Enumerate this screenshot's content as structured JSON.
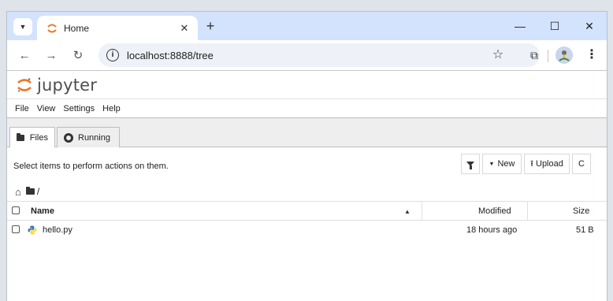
{
  "browser": {
    "tab_title": "Home",
    "tab_close": "✕",
    "new_tab": "+",
    "url": "localhost:8888/tree",
    "window_controls": {
      "minimize": "—",
      "maximize": "☐",
      "close": "✕"
    }
  },
  "jupyter": {
    "logo_text": "jupyter",
    "menu": [
      "File",
      "View",
      "Settings",
      "Help"
    ],
    "tabs": {
      "files": "Files",
      "running": "Running"
    },
    "select_hint": "Select items to perform actions on them.",
    "buttons": {
      "new": "New",
      "upload": "Upload",
      "refresh": "C"
    },
    "breadcrumb_path": "/",
    "columns": {
      "name": "Name",
      "modified": "Modified",
      "size": "Size"
    },
    "files": [
      {
        "name": "hello.py",
        "modified": "18 hours ago",
        "size": "51 B"
      }
    ]
  },
  "colors": {
    "tab_strip": "#d3e3fd",
    "jupyter_orange": "#f37726"
  },
  "icons": [
    "tab-search-icon",
    "jupyter-favicon",
    "back-arrow-icon",
    "forward-arrow-icon",
    "reload-icon",
    "site-info-icon",
    "bookmark-star-icon",
    "extensions-icon",
    "profile-avatar",
    "kebab-menu-icon",
    "folder-icon",
    "running-icon",
    "filter-icon",
    "home-icon",
    "python-file-icon"
  ]
}
